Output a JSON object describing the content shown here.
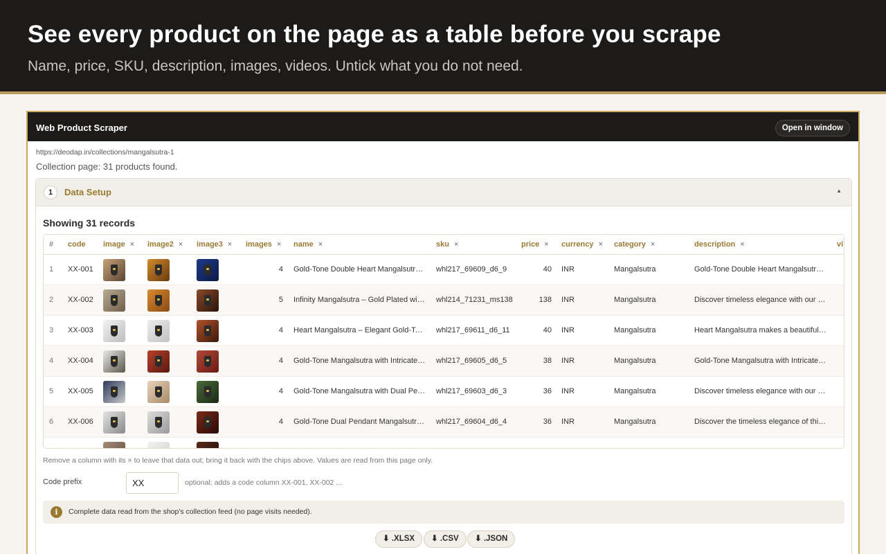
{
  "hero": {
    "title": "See every product on the page as a table before you scrape",
    "subtitle": "Name, price, SKU, description, images, videos. Untick what you do not need."
  },
  "app": {
    "title": "Web Product Scraper",
    "open_window_label": "Open in window",
    "url": "https://deodap.in/collections/mangalsutra-1",
    "status": "Collection page: 31 products found."
  },
  "setup": {
    "step": "1",
    "title": "Data Setup",
    "records_label": "Showing 31 records"
  },
  "table": {
    "columns": [
      "#",
      "code",
      "image",
      "image2",
      "image3",
      "images",
      "name",
      "sku",
      "price",
      "currency",
      "category",
      "description",
      "vi"
    ],
    "remove_icon": "×",
    "rows": [
      {
        "n": "1",
        "code": "XX-001",
        "images": "4",
        "name": "Gold-Tone Double Heart Mangalsutra Necklace",
        "sku": "whl217_69609_d6_9",
        "price": "40",
        "currency": "INR",
        "category": "Mangalsutra",
        "description": "Gold-Tone Double Heart Mangalsutra Necklace"
      },
      {
        "n": "2",
        "code": "XX-002",
        "images": "5",
        "name": "Infinity Mangalsutra – Gold Plated with Black Beads",
        "sku": "whl214_71231_ms138",
        "price": "138",
        "currency": "INR",
        "category": "Mangalsutra",
        "description": "Discover timeless elegance with our Infinity Mangalsutra"
      },
      {
        "n": "3",
        "code": "XX-003",
        "images": "4",
        "name": "Heart Mangalsutra – Elegant Gold-Tone Design",
        "sku": "whl217_69611_d6_11",
        "price": "40",
        "currency": "INR",
        "category": "Mangalsutra",
        "description": "Heart Mangalsutra makes a beautiful gift"
      },
      {
        "n": "4",
        "code": "XX-004",
        "images": "4",
        "name": "Gold-Tone Mangalsutra with Intricate Pendant",
        "sku": "whl217_69605_d6_5",
        "price": "38",
        "currency": "INR",
        "category": "Mangalsutra",
        "description": "Gold-Tone Mangalsutra with Intricate Pendant"
      },
      {
        "n": "5",
        "code": "XX-005",
        "images": "4",
        "name": "Gold-Tone Mangalsutra with Dual Pendant",
        "sku": "whl217_69603_d6_3",
        "price": "36",
        "currency": "INR",
        "category": "Mangalsutra",
        "description": "Discover timeless elegance with our Mangalsutra"
      },
      {
        "n": "6",
        "code": "XX-006",
        "images": "4",
        "name": "Gold-Tone Dual Pendant Mangalsutra Necklace",
        "sku": "whl217_69604_d6_4",
        "price": "36",
        "currency": "INR",
        "category": "Mangalsutra",
        "description": "Discover the timeless elegance of this Mangalsutra"
      }
    ]
  },
  "hint": "Remove a column with its × to leave that data out; bring it back with the chips above. Values are read from this page only.",
  "prefix": {
    "label": "Code prefix",
    "value": "XX",
    "note": "optional: adds a code column XX-001, XX-002 ..."
  },
  "info": {
    "icon": "info-icon",
    "text": "Complete data read from the shop's collection feed (no page visits needed)."
  },
  "export": {
    "xlsx": "⬇ .XLSX",
    "csv": "⬇ .CSV",
    "json": "⬇ .JSON"
  }
}
